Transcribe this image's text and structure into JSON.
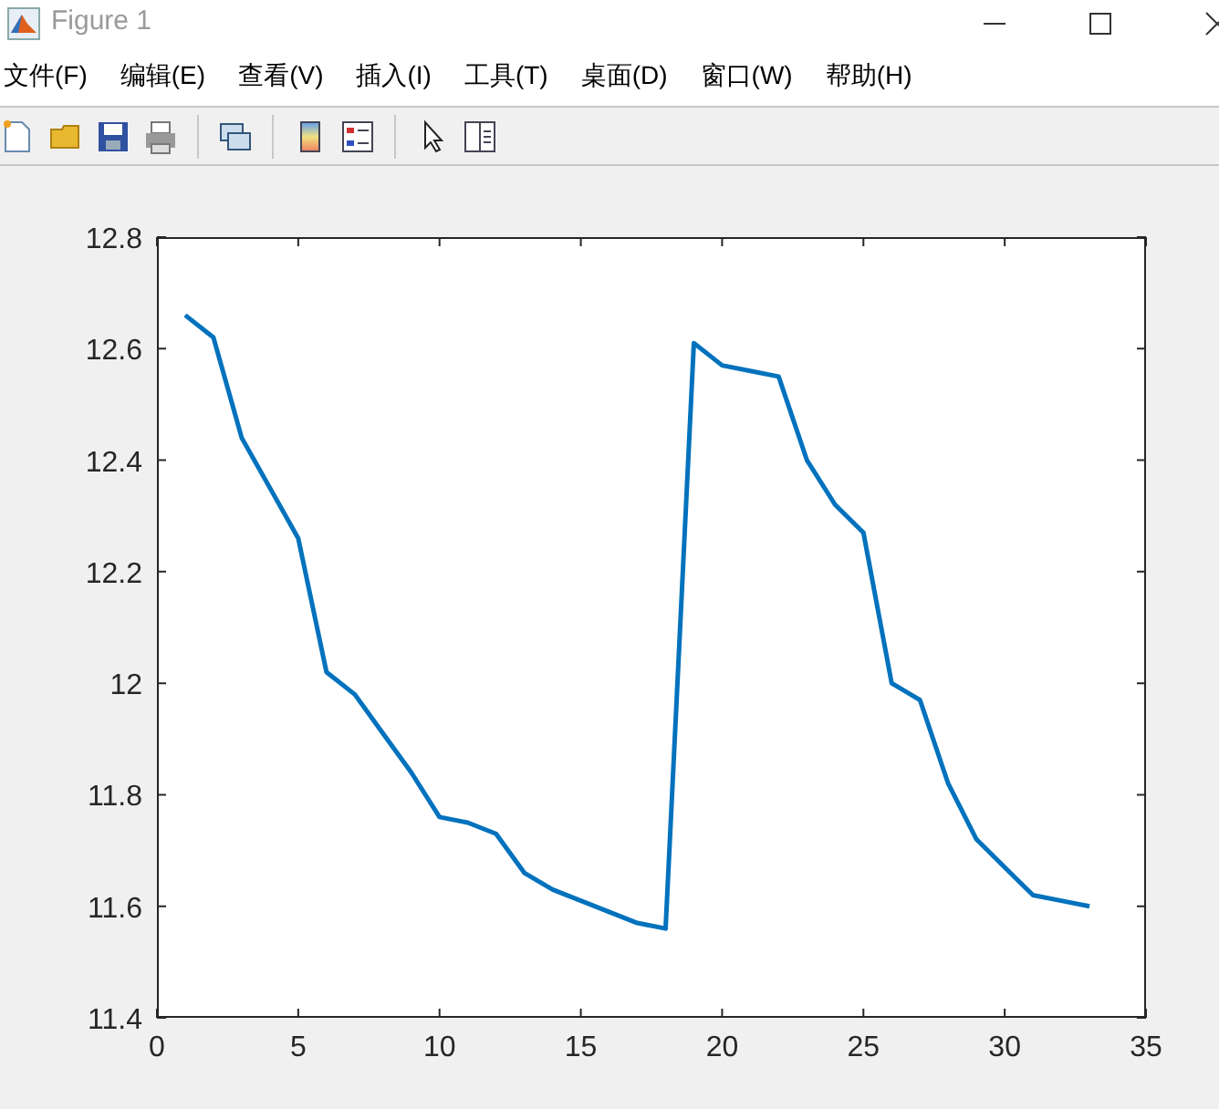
{
  "window": {
    "title": "Figure 1"
  },
  "menu": [
    "文件(F)",
    "编辑(E)",
    "查看(V)",
    "插入(I)",
    "工具(T)",
    "桌面(D)",
    "窗口(W)",
    "帮助(H)"
  ],
  "chart_data": {
    "type": "line",
    "x": [
      1,
      2,
      3,
      4,
      5,
      6,
      7,
      8,
      9,
      10,
      11,
      12,
      13,
      14,
      15,
      16,
      17,
      18,
      19,
      20,
      21,
      22,
      23,
      24,
      25,
      26,
      27,
      28,
      29,
      30,
      31,
      32,
      33
    ],
    "series": [
      {
        "color": "#0072bd",
        "values": [
          12.66,
          12.62,
          12.44,
          12.35,
          12.26,
          12.02,
          11.98,
          11.91,
          11.84,
          11.76,
          11.75,
          11.73,
          11.66,
          11.63,
          11.61,
          11.59,
          11.57,
          11.56,
          12.61,
          12.57,
          12.56,
          12.55,
          12.4,
          12.32,
          12.27,
          12.0,
          11.97,
          11.82,
          11.72,
          11.67,
          11.62,
          11.61,
          11.6
        ]
      }
    ],
    "xlim": [
      0,
      35
    ],
    "ylim": [
      11.4,
      12.8
    ],
    "xticks": [
      0,
      5,
      10,
      15,
      20,
      25,
      30,
      35
    ],
    "yticks": [
      {
        "value": 11.4,
        "label": "11.4"
      },
      {
        "value": 11.6,
        "label": "11.6"
      },
      {
        "value": 11.8,
        "label": "11.8"
      },
      {
        "value": 12,
        "label": "12"
      },
      {
        "value": 12.2,
        "label": "12.2"
      },
      {
        "value": 12.4,
        "label": "12.4"
      },
      {
        "value": 12.6,
        "label": "12.6"
      },
      {
        "value": 12.8,
        "label": "12.8"
      }
    ]
  }
}
